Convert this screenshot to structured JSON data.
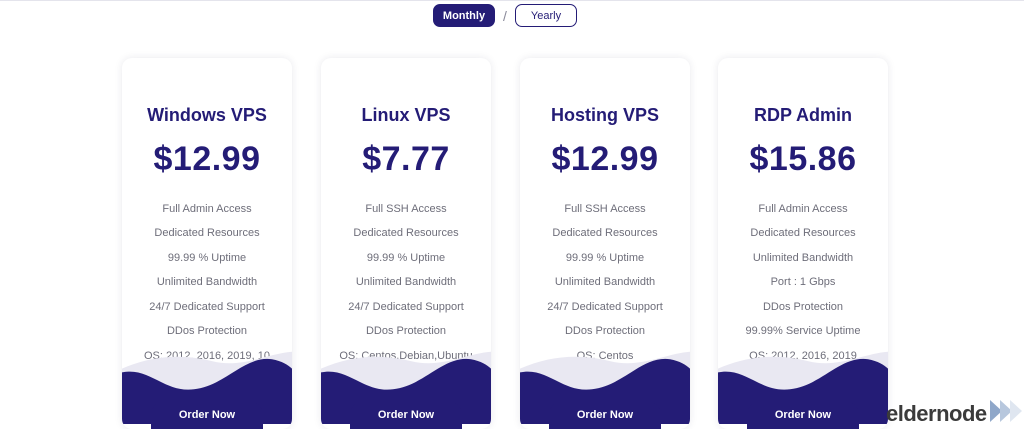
{
  "billing_toggle": {
    "monthly_label": "Monthly",
    "separator": "/",
    "yearly_label": "Yearly",
    "selected": "Monthly"
  },
  "colors": {
    "primary": "#241c76",
    "feature_text": "#6e6e7a",
    "wave_light": "#e9e8f2"
  },
  "plans": [
    {
      "title": "Windows VPS",
      "price": "$12.99",
      "features": [
        "Full Admin Access",
        "Dedicated Resources",
        "99.99 % Uptime",
        "Unlimited Bandwidth",
        "24/7 Dedicated Support",
        "DDos Protection",
        "OS: 2012, 2016, 2019, 10"
      ],
      "order_label": "Order Now"
    },
    {
      "title": "Linux VPS",
      "price": "$7.77",
      "features": [
        "Full SSH Access",
        "Dedicated Resources",
        "99.99 % Uptime",
        "Unlimited Bandwidth",
        "24/7 Dedicated Support",
        "DDos Protection",
        "OS: Centos,Debian,Ubuntu"
      ],
      "order_label": "Order Now"
    },
    {
      "title": "Hosting VPS",
      "price": "$12.99",
      "features": [
        "Full SSH Access",
        "Dedicated Resources",
        "99.99 % Uptime",
        "Unlimited Bandwidth",
        "24/7 Dedicated Support",
        "DDos Protection",
        "OS: Centos"
      ],
      "order_label": "Order Now"
    },
    {
      "title": "RDP Admin",
      "price": "$15.86",
      "features": [
        "Full Admin Access",
        "Dedicated Resources",
        "Unlimited Bandwidth",
        "Port : 1 Gbps",
        "DDos Protection",
        "99.99% Service Uptime",
        "OS: 2012, 2016, 2019"
      ],
      "order_label": "Order Now"
    }
  ],
  "brand": {
    "name": "eldernode",
    "icon": "play-arrows-icon"
  }
}
